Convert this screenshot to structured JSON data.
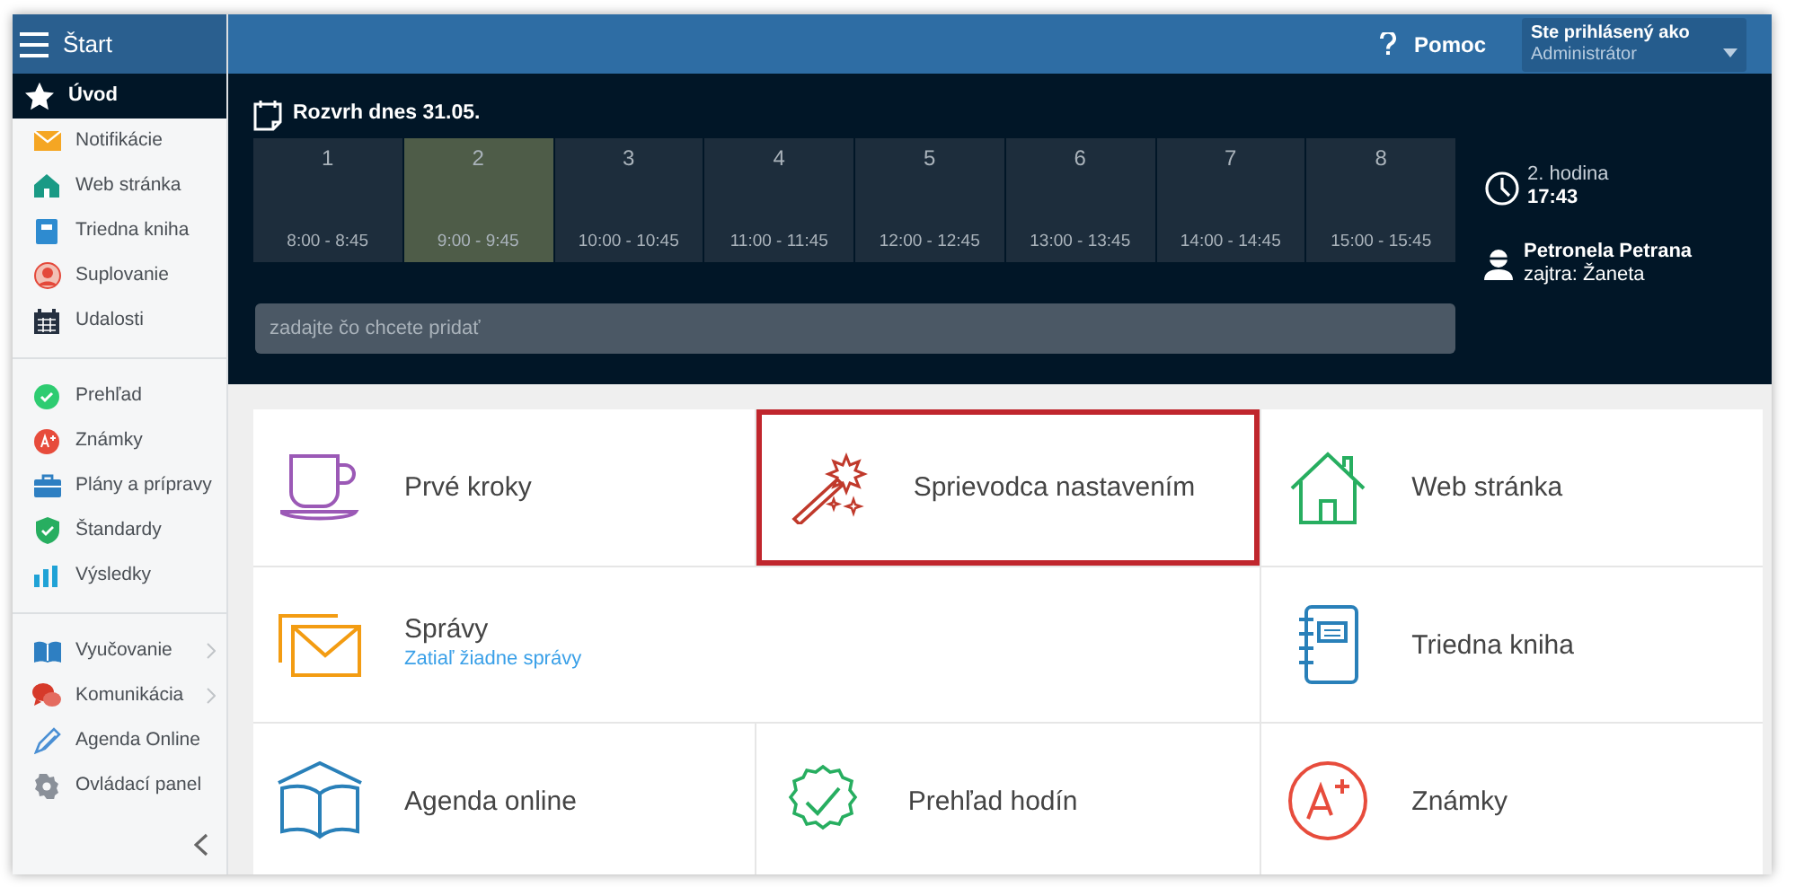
{
  "sidebar": {
    "title": "Štart",
    "groups": [
      [
        {
          "label": "Úvod",
          "selected": true,
          "has_submenu": false
        },
        {
          "label": "Notifikácie",
          "selected": false,
          "has_submenu": false
        },
        {
          "label": "Web stránka",
          "selected": false,
          "has_submenu": false
        },
        {
          "label": "Triedna kniha",
          "selected": false,
          "has_submenu": false
        },
        {
          "label": "Suplovanie",
          "selected": false,
          "has_submenu": false
        },
        {
          "label": "Udalosti",
          "selected": false,
          "has_submenu": false
        }
      ],
      [
        {
          "label": "Prehľad",
          "selected": false,
          "has_submenu": false
        },
        {
          "label": "Známky",
          "selected": false,
          "has_submenu": false
        },
        {
          "label": "Plány a prípravy",
          "selected": false,
          "has_submenu": false
        },
        {
          "label": "Štandardy",
          "selected": false,
          "has_submenu": false
        },
        {
          "label": "Výsledky",
          "selected": false,
          "has_submenu": false
        }
      ],
      [
        {
          "label": "Vyučovanie",
          "selected": false,
          "has_submenu": true
        },
        {
          "label": "Komunikácia",
          "selected": false,
          "has_submenu": true
        },
        {
          "label": "Agenda Online",
          "selected": false,
          "has_submenu": false
        },
        {
          "label": "Ovládací panel",
          "selected": false,
          "has_submenu": false
        }
      ]
    ]
  },
  "header": {
    "help": "Pomoc",
    "user": {
      "caption": "Ste prihlásený ako",
      "value": "Administrátor"
    }
  },
  "schedule": {
    "title": "Rozvrh dnes 31.05.",
    "lessons": [
      {
        "number": "1",
        "time": "8:00 - 8:45",
        "selected": false
      },
      {
        "number": "2",
        "time": "9:00 - 9:45",
        "selected": true
      },
      {
        "number": "3",
        "time": "10:00 - 10:45",
        "selected": false
      },
      {
        "number": "4",
        "time": "11:00 - 11:45",
        "selected": false
      },
      {
        "number": "5",
        "time": "12:00 - 12:45",
        "selected": false
      },
      {
        "number": "6",
        "time": "13:00 - 13:45",
        "selected": false
      },
      {
        "number": "7",
        "time": "14:00 - 14:45",
        "selected": false
      },
      {
        "number": "8",
        "time": "15:00 - 15:45",
        "selected": false
      }
    ],
    "current": {
      "lesson": "2. hodina",
      "time": "17:43"
    },
    "substitute": {
      "name": "Petronela Petrana",
      "note": "zajtra: Žaneta"
    },
    "input": {
      "placeholder": "zadajte čo chcete pridať"
    }
  },
  "tiles": [
    {
      "title": "Prvé kroky",
      "wide": false,
      "highlighted": false
    },
    {
      "title": "Sprievodca nastavením",
      "wide": false,
      "highlighted": true
    },
    {
      "title": "Web stránka",
      "wide": false,
      "highlighted": false
    },
    {
      "title": "Správy",
      "subtitle": "Zatiaľ žiadne správy",
      "wide": true,
      "highlighted": false
    },
    {
      "title": "Triedna kniha",
      "wide": false,
      "highlighted": false
    },
    {
      "title": "Agenda online",
      "wide": false,
      "highlighted": false
    },
    {
      "title": "Prehľad hodín",
      "wide": false,
      "highlighted": false
    },
    {
      "title": "Známky",
      "wide": false,
      "highlighted": false
    }
  ]
}
